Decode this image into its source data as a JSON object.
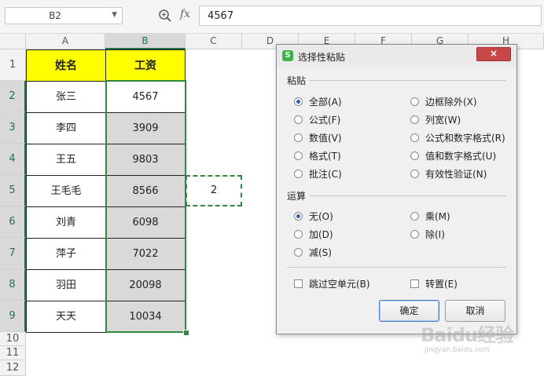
{
  "formula_bar": {
    "name_box": "B2",
    "fx_label": "fx",
    "content": "4567"
  },
  "columns": [
    "A",
    "B",
    "C",
    "D",
    "E",
    "F",
    "G",
    "H"
  ],
  "rows": [
    "1",
    "2",
    "3",
    "4",
    "5",
    "6",
    "7",
    "8",
    "9",
    "10",
    "11",
    "12"
  ],
  "table": {
    "header_name": "姓名",
    "header_salary": "工资",
    "names": [
      "张三",
      "李四",
      "王五",
      "王毛毛",
      "刘青",
      "萍子",
      "羽田",
      "天天"
    ],
    "salaries": [
      "4567",
      "3909",
      "9803",
      "8566",
      "6098",
      "7022",
      "20098",
      "10034"
    ]
  },
  "copied_cell": "2",
  "dialog": {
    "title": "选择性粘贴",
    "app_icon": "S",
    "close_label": "×",
    "paste_section": "粘贴",
    "paste_options_left": [
      "全部(A)",
      "公式(F)",
      "数值(V)",
      "格式(T)",
      "批注(C)"
    ],
    "paste_options_right": [
      "边框除外(X)",
      "列宽(W)",
      "公式和数字格式(R)",
      "值和数字格式(U)",
      "有效性验证(N)"
    ],
    "paste_selected": "全部(A)",
    "operation_section": "运算",
    "operation_options_left": [
      "无(O)",
      "加(D)",
      "减(S)"
    ],
    "operation_options_right": [
      "乘(M)",
      "除(I)"
    ],
    "operation_selected": "无(O)",
    "skip_blanks": "跳过空单元(B)",
    "transpose": "转置(E)",
    "ok": "确定",
    "cancel": "取消"
  },
  "watermark": {
    "brand": "Baidu经验",
    "url": "jingyan.baidu.com"
  },
  "colors": {
    "header_fill": "#ffff00",
    "selection": "#2f8a3e",
    "selected_fill": "#d9d9d9"
  }
}
